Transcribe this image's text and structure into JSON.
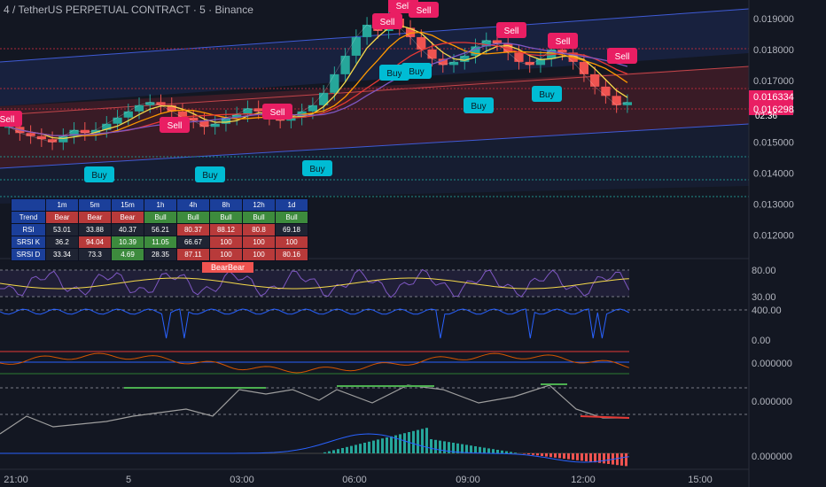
{
  "header": {
    "title": "4 / TetherUS PERPETUAL CONTRACT · 5 · Binance"
  },
  "colors": {
    "bg": "#131722",
    "sell": "#e91e63",
    "buy": "#00bcd4",
    "up": "#26a69a",
    "down": "#ef5350"
  },
  "price_axis": {
    "ticks": [
      "0.019000",
      "0.018000",
      "0.017000",
      "0.016000",
      "0.015000",
      "0.014000",
      "0.013000",
      "0.012000"
    ]
  },
  "price_tags": {
    "last": "0.016334",
    "current": "0.016298",
    "countdown": "02:36"
  },
  "time_axis": [
    "21:00",
    "5",
    "03:00",
    "06:00",
    "09:00",
    "12:00",
    "15:00"
  ],
  "signals": {
    "sell": "Sell",
    "buy": "Buy",
    "sell_count": 9,
    "buy_count": 8
  },
  "trend_table": {
    "timeframes": [
      "1m",
      "5m",
      "15m",
      "1h",
      "4h",
      "8h",
      "12h",
      "1d"
    ],
    "rows": [
      {
        "label": "Trend",
        "values": [
          "Bear",
          "Bear",
          "Bear",
          "Bull",
          "Bull",
          "Bull",
          "Bull",
          "Bull"
        ]
      },
      {
        "label": "RSI",
        "values": [
          "53.01",
          "33.88",
          "40.37",
          "56.21",
          "80.37",
          "88.12",
          "80.8",
          "69.18"
        ]
      },
      {
        "label": "SRSI K",
        "values": [
          "36.2",
          "94.04",
          "10.39",
          "11.05",
          "66.67",
          "100",
          "100",
          "100"
        ]
      },
      {
        "label": "SRSI D",
        "values": [
          "33.34",
          "73.3",
          "4.69",
          "28.35",
          "87.11",
          "100",
          "100",
          "80.16"
        ]
      }
    ]
  },
  "indicators": {
    "bearbear_label": "BearBear",
    "rsi_ticks": [
      "80.00",
      "30.00"
    ],
    "pane2_ticks": [
      "400.00",
      "0.00"
    ],
    "pane3_tick": "0.000000",
    "pane4_tick": "0.000000",
    "pane5_tick": "0.000000"
  },
  "chart_data": {
    "type": "candlestick",
    "x": [
      "21:00",
      "5",
      "03:00",
      "06:00",
      "09:00",
      "12:00",
      "15:00"
    ],
    "ylim": [
      0.0113,
      0.0196
    ],
    "close_series": [
      0.0155,
      0.0153,
      0.0152,
      0.0151,
      0.015,
      0.0152,
      0.0154,
      0.0153,
      0.0154,
      0.0156,
      0.0158,
      0.016,
      0.0162,
      0.0163,
      0.0162,
      0.016,
      0.0158,
      0.0157,
      0.0155,
      0.0156,
      0.0158,
      0.0159,
      0.0161,
      0.016,
      0.0158,
      0.0157,
      0.0158,
      0.016,
      0.0162,
      0.0166,
      0.0172,
      0.0178,
      0.0184,
      0.0188,
      0.0186,
      0.019,
      0.0187,
      0.0184,
      0.018,
      0.0177,
      0.0175,
      0.0176,
      0.0178,
      0.0181,
      0.0183,
      0.0182,
      0.0179,
      0.0176,
      0.0175,
      0.0177,
      0.018,
      0.0179,
      0.0176,
      0.0172,
      0.0168,
      0.0165,
      0.0162,
      0.0163
    ],
    "last": 0.016334,
    "current": 0.016298
  }
}
